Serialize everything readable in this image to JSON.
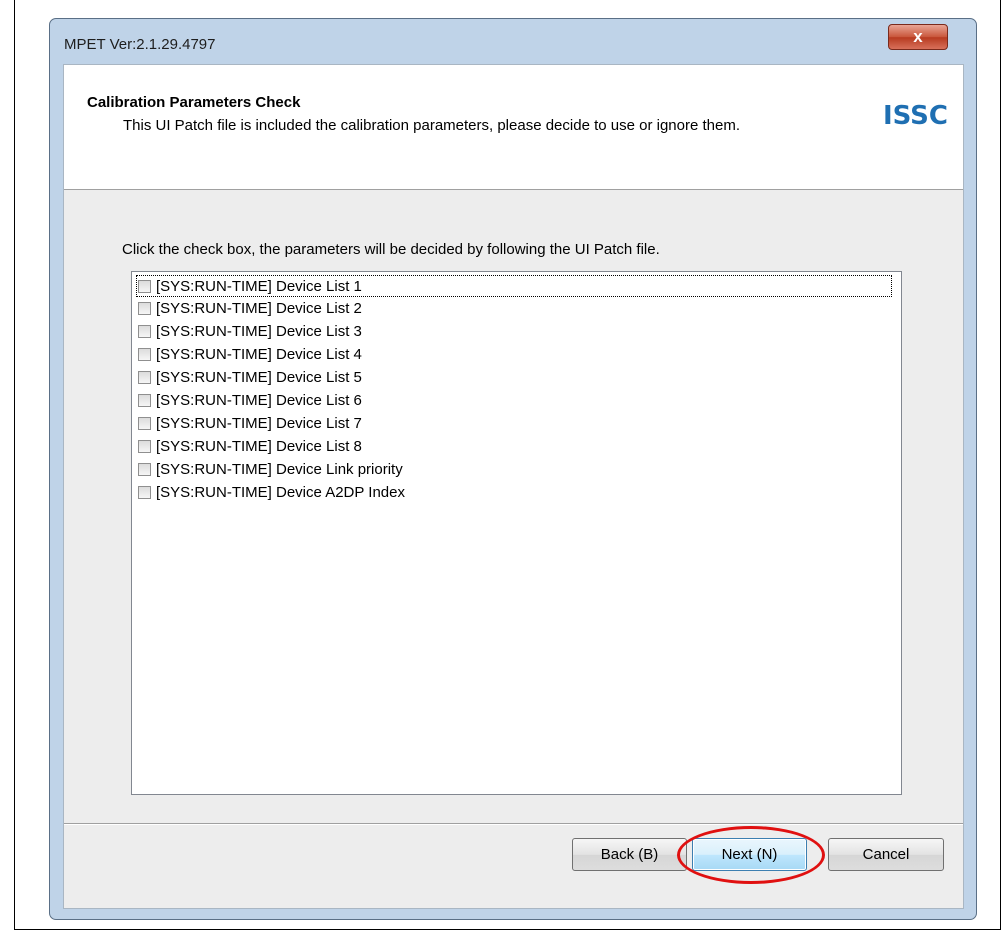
{
  "window": {
    "title": "MPET Ver:2.1.29.4797",
    "close_glyph": "x"
  },
  "header": {
    "title": "Calibration Parameters Check",
    "description": "This UI Patch file is included the calibration parameters, please decide to use or ignore them.",
    "logo_text": "ISSC"
  },
  "main": {
    "instructions": "Click the check box, the parameters will be decided by following the UI Patch file.",
    "items": [
      {
        "label": "[SYS:RUN-TIME] Device List 1",
        "checked": false
      },
      {
        "label": "[SYS:RUN-TIME] Device List 2",
        "checked": false
      },
      {
        "label": "[SYS:RUN-TIME] Device List 3",
        "checked": false
      },
      {
        "label": "[SYS:RUN-TIME] Device List 4",
        "checked": false
      },
      {
        "label": "[SYS:RUN-TIME] Device List 5",
        "checked": false
      },
      {
        "label": "[SYS:RUN-TIME] Device List 6",
        "checked": false
      },
      {
        "label": "[SYS:RUN-TIME] Device List 7",
        "checked": false
      },
      {
        "label": "[SYS:RUN-TIME] Device List 8",
        "checked": false
      },
      {
        "label": "[SYS:RUN-TIME] Device Link priority",
        "checked": false
      },
      {
        "label": "[SYS:RUN-TIME] Device A2DP Index",
        "checked": false
      }
    ]
  },
  "footer": {
    "back_label": "Back (B)",
    "next_label": "Next (N)",
    "cancel_label": "Cancel"
  },
  "colors": {
    "logo": "#1f6fb2",
    "highlight_ring": "#e01010",
    "window_frame": "#bfd3e8"
  }
}
